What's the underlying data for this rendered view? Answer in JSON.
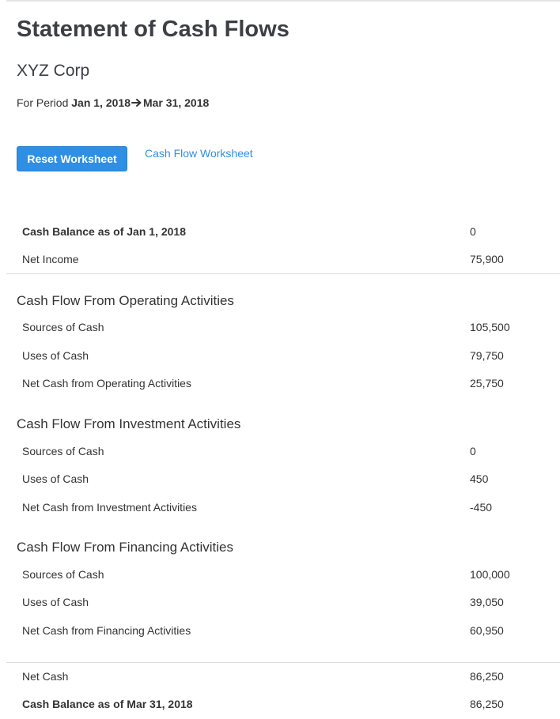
{
  "header": {
    "title": "Statement of Cash Flows",
    "company": "XYZ Corp",
    "period_prefix": "For Period",
    "period_start": "Jan 1, 2018",
    "period_end": "Mar 31, 2018"
  },
  "actions": {
    "reset_label": "Reset Worksheet",
    "worksheet_link": "Cash Flow Worksheet"
  },
  "summary_top": {
    "opening_label": "Cash Balance as of Jan 1, 2018",
    "opening_value": "0",
    "net_income_label": "Net Income",
    "net_income_value": "75,900"
  },
  "operating": {
    "heading": "Cash Flow From Operating Activities",
    "sources_label": "Sources of Cash",
    "sources_value": "105,500",
    "uses_label": "Uses of Cash",
    "uses_value": "79,750",
    "net_label": "Net Cash from Operating Activities",
    "net_value": "25,750"
  },
  "investment": {
    "heading": "Cash Flow From Investment Activities",
    "sources_label": "Sources of Cash",
    "sources_value": "0",
    "uses_label": "Uses of Cash",
    "uses_value": "450",
    "net_label": "Net Cash from Investment Activities",
    "net_value": "-450"
  },
  "financing": {
    "heading": "Cash Flow From Financing Activities",
    "sources_label": "Sources of Cash",
    "sources_value": "100,000",
    "uses_label": "Uses of Cash",
    "uses_value": "39,050",
    "net_label": "Net Cash from Financing Activities",
    "net_value": "60,950"
  },
  "summary_bottom": {
    "net_cash_label": "Net Cash",
    "net_cash_value": "86,250",
    "closing_label": "Cash Balance as of Mar 31, 2018",
    "closing_value": "86,250"
  },
  "colors": {
    "accent": "#2f8fe4",
    "title": "#3c3f44",
    "text": "#333333",
    "divider": "#dddddd"
  },
  "icons": {
    "period_separator": "arrow-right-icon"
  }
}
